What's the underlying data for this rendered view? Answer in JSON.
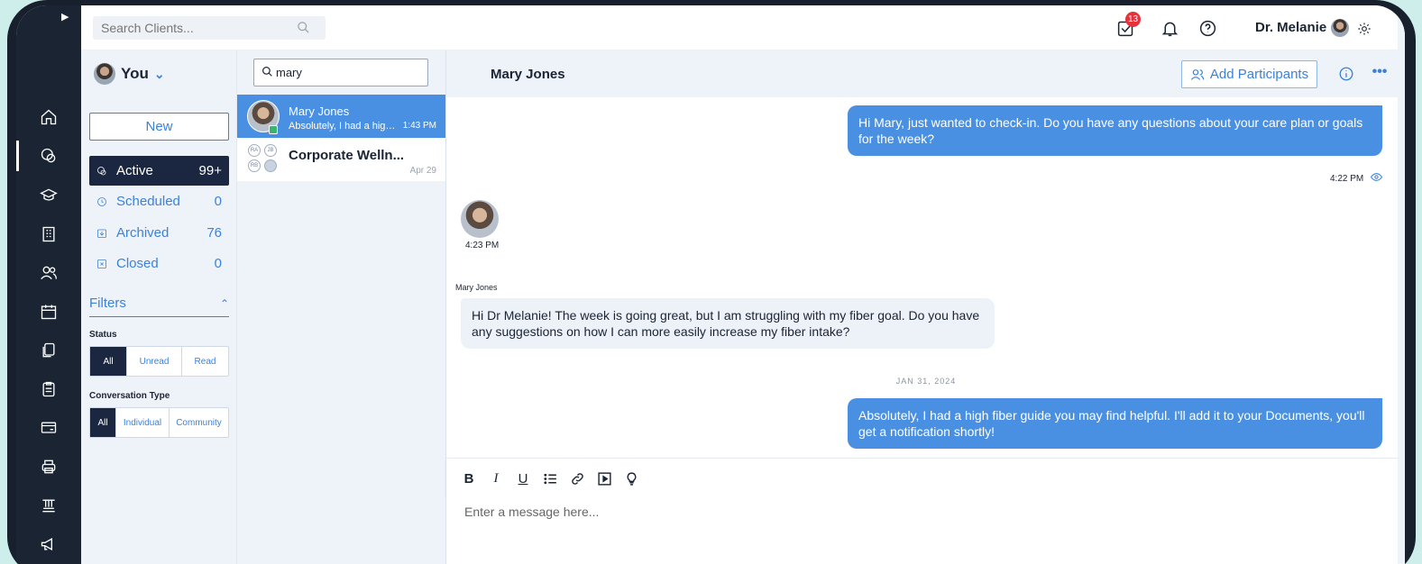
{
  "topbar": {
    "search_placeholder": "Search Clients...",
    "tasks_badge": "13",
    "user_name": "Dr. Melanie"
  },
  "rail": {
    "icons": [
      "home-icon",
      "chat-icon",
      "graduation-cap-icon",
      "building-icon",
      "users-icon",
      "calendar-icon",
      "documents-icon",
      "clipboard-icon",
      "billing-icon",
      "printer-icon",
      "awards-icon",
      "megaphone-icon"
    ]
  },
  "filter_panel": {
    "owner": "You",
    "new_label": "New",
    "folders": [
      {
        "label": "Active",
        "count": "99+"
      },
      {
        "label": "Scheduled",
        "count": "0"
      },
      {
        "label": "Archived",
        "count": "76"
      },
      {
        "label": "Closed",
        "count": "0"
      }
    ],
    "filters_label": "Filters",
    "status_label": "Status",
    "status_options": [
      "All",
      "Unread",
      "Read"
    ],
    "type_label": "Conversation Type",
    "type_options": [
      "All",
      "Individual",
      "Community"
    ]
  },
  "conversation_list": {
    "search_value": "mary",
    "items": [
      {
        "name": "Mary Jones",
        "preview": "Absolutely, I had a high fiber guide",
        "time": "1:43 PM"
      },
      {
        "name": "Corporate Welln...",
        "preview": "",
        "time": "Apr 29",
        "participants": [
          "RA",
          "JB",
          "RB"
        ]
      }
    ]
  },
  "chat": {
    "title": "Mary Jones",
    "add_participants_label": "Add Participants",
    "messages": [
      {
        "direction": "out",
        "text": "Hi Mary, just wanted to check-in. Do you have any questions about your care plan or goals for the week?",
        "time": "4:22 PM"
      },
      {
        "direction": "in",
        "time": "4:23 PM"
      },
      {
        "direction": "in",
        "sender": "Mary Jones",
        "text": "Hi Dr Melanie! The week is going great, but I am struggling with my fiber goal. Do you have any suggestions on how I can more easily increase my fiber intake?"
      },
      {
        "direction": "out",
        "text": "Absolutely, I had a high fiber guide you may find helpful. I'll add it to your Documents, you'll get a notification shortly!"
      }
    ],
    "date_divider": "JAN 31, 2024",
    "composer_placeholder": "Enter a message here...",
    "toolbar": [
      "B",
      "I",
      "U"
    ]
  },
  "colors": {
    "accent": "#4a90e2",
    "nav_dark": "#1b2433",
    "panel_bg": "#eef2f9",
    "badge": "#e6323b"
  }
}
